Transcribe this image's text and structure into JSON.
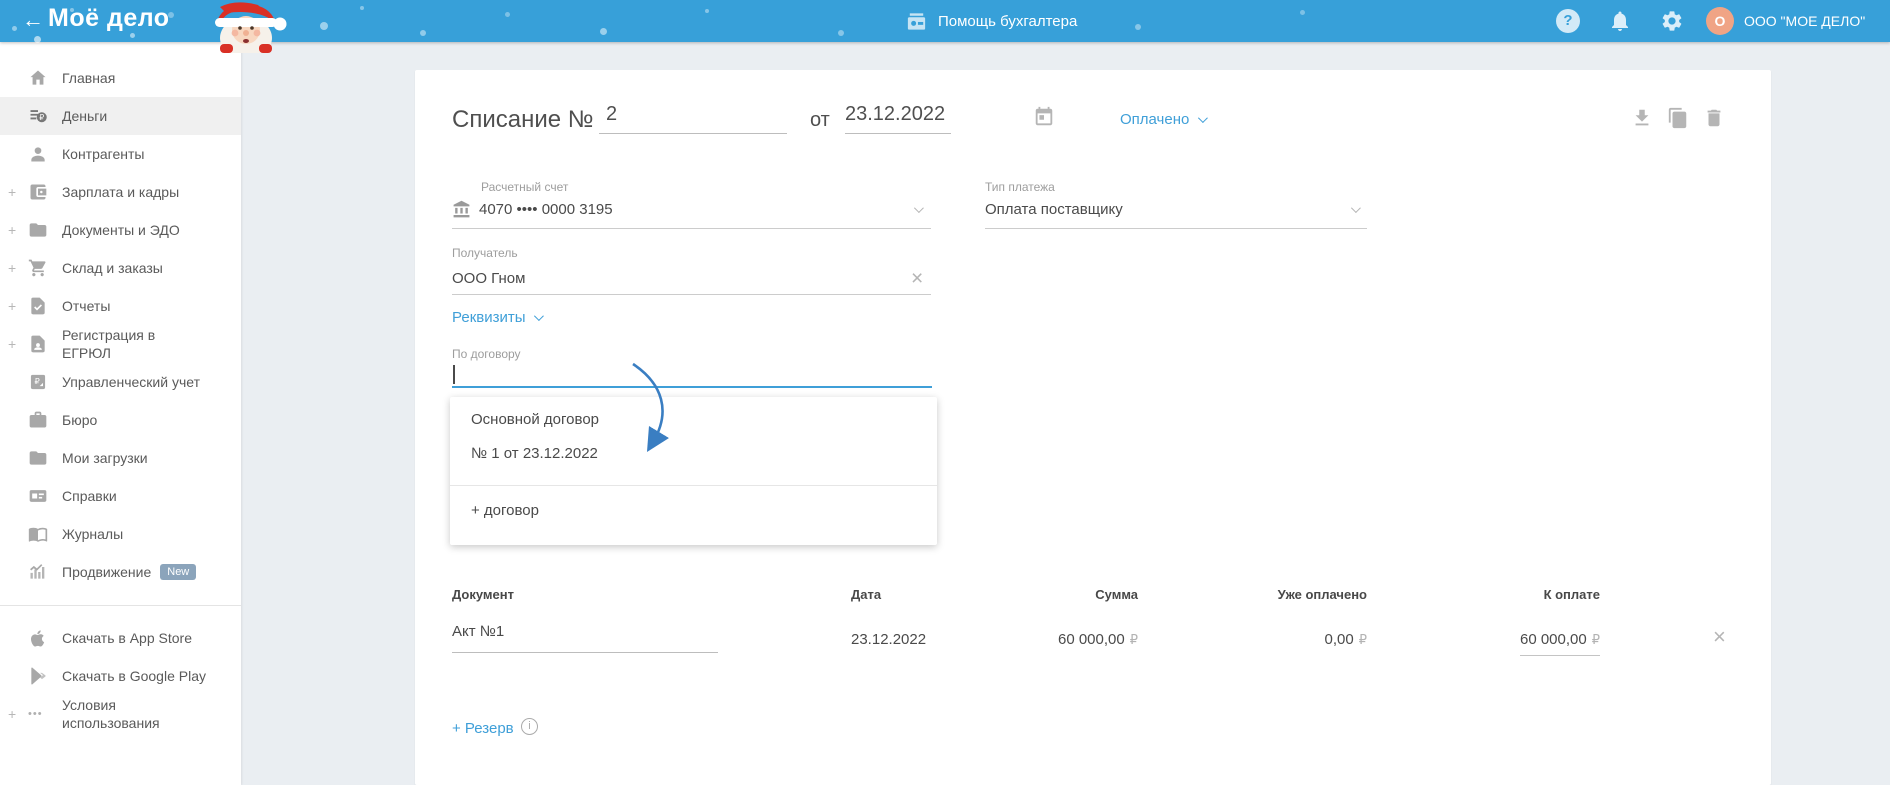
{
  "colors": {
    "topbar": "#37a0d9",
    "link_blue": "#3f9fd8",
    "avatar_orange": "#f0a485",
    "badge_gray_blue": "#8ba4bb",
    "focus_underline": "#3f9fd8"
  },
  "header": {
    "back_arrow": "←",
    "logo": "Моё дело",
    "help_label": "Помощь бухгалтера",
    "question_mark": "?",
    "avatar_letter": "О",
    "company_name": "ООО \"МОЕ ДЕЛО\""
  },
  "sidebar": {
    "items": [
      {
        "label": "Главная"
      },
      {
        "label": "Деньги"
      },
      {
        "label": "Контрагенты"
      },
      {
        "label": "Зарплата и кадры",
        "expand": "+"
      },
      {
        "label": "Документы и ЭДО",
        "expand": "+"
      },
      {
        "label": "Склад и заказы",
        "expand": "+"
      },
      {
        "label": "Отчеты",
        "expand": "+"
      },
      {
        "label": "Регистрация в ЕГРЮЛ",
        "expand": "+"
      },
      {
        "label": "Управленческий учет"
      },
      {
        "label": "Бюро"
      },
      {
        "label": "Мои загрузки"
      },
      {
        "label": "Справки"
      },
      {
        "label": "Журналы"
      },
      {
        "label": "Продвижение",
        "badge": "New"
      }
    ],
    "footer_items": [
      {
        "label": "Скачать в App Store"
      },
      {
        "label": "Скачать в Google Play"
      },
      {
        "label": "Условия использования",
        "expand": "+",
        "dots": "•••"
      }
    ]
  },
  "document": {
    "title_label": "Списание №",
    "number": "2",
    "date_preposition": "от",
    "date": "23.12.2022",
    "status": "Оплачено",
    "fields": {
      "account": {
        "label": "Расчетный счет",
        "value": "4070 •••• 0000 3195"
      },
      "payment_type": {
        "label": "Тип платежа",
        "value": "Оплата поставщику"
      },
      "recipient": {
        "label": "Получатель",
        "value": "ООО Гном",
        "clear": "×"
      },
      "contract": {
        "label": "По договору",
        "value": ""
      }
    },
    "requisites_link": "Реквизиты",
    "contract_dropdown": {
      "main_option_line1": "Основной договор",
      "main_option_line2": "№ 1 от 23.12.2022",
      "add_option": "+ договор"
    },
    "reserve_link": "+ Резерв",
    "info_mark": "i",
    "remove_row": "×"
  },
  "table": {
    "headers": {
      "document": "Документ",
      "date": "Дата",
      "sum": "Сумма",
      "paid": "Уже оплачено",
      "to_pay": "К оплате"
    },
    "row": {
      "document": "Акт №1",
      "date": "23.12.2022",
      "sum": "60 000,00",
      "paid": "0,00",
      "to_pay": "60 000,00"
    },
    "currency": "₽"
  }
}
